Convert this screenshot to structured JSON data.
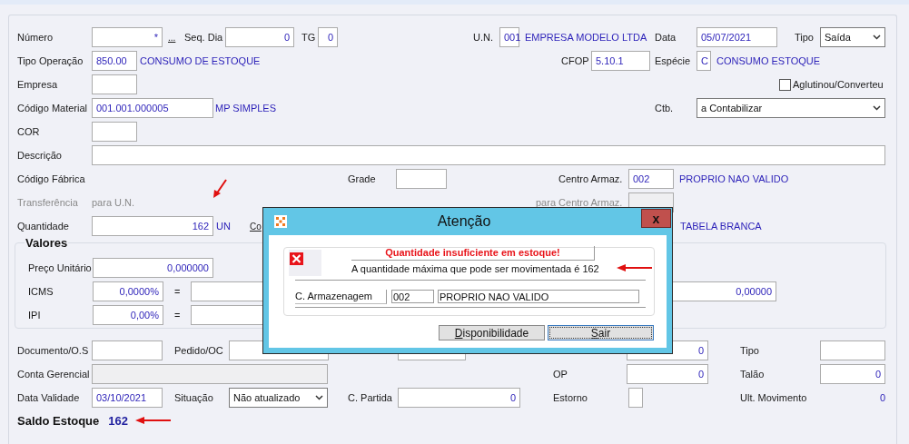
{
  "form": {
    "rows": [
      {
        "items": [
          {
            "kind": "label",
            "text": "Número"
          },
          {
            "kind": "field",
            "value": "*",
            "disabled": false
          },
          {
            "kind": "link",
            "text": "..."
          },
          {
            "kind": "label",
            "text": "Seq. Dia"
          },
          {
            "kind": "field",
            "value": "0",
            "disabled": false
          },
          {
            "kind": "label",
            "text": "TG"
          },
          {
            "kind": "field",
            "value": "0",
            "disabled": false
          },
          {
            "kind": "label",
            "text": "U.N."
          },
          {
            "kind": "field",
            "value": "001",
            "disabled": false
          },
          {
            "kind": "info",
            "text": "EMPRESA MODELO LTDA"
          },
          {
            "kind": "label",
            "text": "Data"
          },
          {
            "kind": "field",
            "value": "05/07/2021",
            "disabled": false
          },
          {
            "kind": "label",
            "text": "Tipo"
          },
          {
            "kind": "select",
            "value": "Saída"
          }
        ]
      },
      {
        "items": [
          {
            "kind": "label",
            "text": "Tipo Operação"
          },
          {
            "kind": "field",
            "value": "850.00",
            "disabled": false
          },
          {
            "kind": "info",
            "text": "CONSUMO DE ESTOQUE"
          },
          {
            "kind": "label",
            "text": "CFOP"
          },
          {
            "kind": "field",
            "value": "5.10.1",
            "disabled": false
          },
          {
            "kind": "label",
            "text": "Espécie"
          },
          {
            "kind": "field",
            "value": "C",
            "disabled": false
          },
          {
            "kind": "info",
            "text": "CONSUMO ESTOQUE"
          }
        ]
      },
      {
        "items": [
          {
            "kind": "label",
            "text": "Empresa"
          },
          {
            "kind": "field",
            "disabled": false
          },
          {
            "kind": "checkbox",
            "text": "Aglutinou/Converteu",
            "checked": false
          }
        ]
      },
      {
        "items": [
          {
            "kind": "label",
            "text": "Código Material"
          },
          {
            "kind": "field",
            "value": "001.001.000005",
            "disabled": false
          },
          {
            "kind": "info",
            "text": "MP SIMPLES"
          },
          {
            "kind": "label",
            "text": "Ctb."
          },
          {
            "kind": "select",
            "value": "a Contabilizar"
          }
        ]
      },
      {
        "items": [
          {
            "kind": "label",
            "text": "COR"
          },
          {
            "kind": "field",
            "disabled": false
          }
        ]
      },
      {
        "items": [
          {
            "kind": "label",
            "text": "Descrição"
          },
          {
            "kind": "field",
            "disabled": false
          }
        ]
      },
      {
        "items": [
          {
            "kind": "label",
            "text": "Código Fábrica"
          },
          {
            "kind": "label",
            "text": "Grade"
          },
          {
            "kind": "field",
            "disabled": false
          },
          {
            "kind": "label",
            "text": "Centro Armaz."
          },
          {
            "kind": "field",
            "value": "002",
            "disabled": false
          },
          {
            "kind": "info",
            "text": "PROPRIO NAO VALIDO"
          }
        ]
      },
      {
        "items": [
          {
            "kind": "muted",
            "text": "Transferência"
          },
          {
            "kind": "muted",
            "text": "para U.N."
          },
          {
            "kind": "muted",
            "text": "para Centro Armaz."
          },
          {
            "kind": "field",
            "disabled": true
          }
        ]
      },
      {
        "items": [
          {
            "kind": "label",
            "text": "Quantidade"
          },
          {
            "kind": "field",
            "value": "162",
            "disabled": false
          },
          {
            "kind": "info",
            "text": "UN"
          },
          {
            "kind": "link",
            "text": "Co"
          },
          {
            "kind": "info",
            "text": "TABELA BRANCA"
          }
        ]
      }
    ],
    "values": {
      "title": "Valores",
      "rows": [
        {
          "items": [
            {
              "kind": "label",
              "text": "Preço Unitário"
            },
            {
              "kind": "field",
              "value": "0,000000",
              "disabled": false
            }
          ]
        },
        {
          "items": [
            {
              "kind": "label",
              "text": "ICMS"
            },
            {
              "kind": "field",
              "value": "0,0000%",
              "disabled": false
            },
            {
              "kind": "label",
              "text": "="
            },
            {
              "kind": "field",
              "disabled": false
            },
            {
              "kind": "field",
              "value": "0,00000",
              "disabled": false
            }
          ]
        },
        {
          "items": [
            {
              "kind": "label",
              "text": "IPI"
            },
            {
              "kind": "field",
              "value": "0,00%",
              "disabled": false
            },
            {
              "kind": "label",
              "text": "="
            },
            {
              "kind": "field",
              "disabled": false
            }
          ]
        }
      ]
    },
    "bottom_rows": [
      {
        "items": [
          {
            "kind": "label",
            "text": "Documento/O.S"
          },
          {
            "kind": "field",
            "disabled": false
          },
          {
            "kind": "label",
            "text": "Pedido/OC"
          },
          {
            "kind": "field",
            "disabled": false
          },
          {
            "kind": "field",
            "disabled": false
          },
          {
            "kind": "field",
            "value": "0",
            "disabled": false
          },
          {
            "kind": "label",
            "text": "Tipo"
          },
          {
            "kind": "field",
            "disabled": false
          }
        ]
      },
      {
        "items": [
          {
            "kind": "label",
            "text": "Conta Gerencial"
          },
          {
            "kind": "field",
            "disabled": true
          },
          {
            "kind": "label",
            "text": "OP"
          },
          {
            "kind": "field",
            "value": "0",
            "disabled": false
          },
          {
            "kind": "label",
            "text": "Talão"
          },
          {
            "kind": "field",
            "value": "0",
            "disabled": false
          }
        ]
      },
      {
        "items": [
          {
            "kind": "label",
            "text": "Data Validade"
          },
          {
            "kind": "field",
            "value": "03/10/2021",
            "disabled": false
          },
          {
            "kind": "label",
            "text": "Situação"
          },
          {
            "kind": "select",
            "value": "Não atualizado"
          },
          {
            "kind": "label",
            "text": "C. Partida"
          },
          {
            "kind": "field",
            "value": "0",
            "disabled": false
          },
          {
            "kind": "label",
            "text": "Estorno"
          },
          {
            "kind": "field",
            "disabled": false
          },
          {
            "kind": "label",
            "text": "Ult. Movimento"
          },
          {
            "kind": "info",
            "text": "0"
          }
        ]
      }
    ],
    "saldo": {
      "label": "Saldo Estoque",
      "value": "162"
    }
  },
  "dialog": {
    "title": "Atenção",
    "close": "x",
    "header": "Quantidade insuficiente em estoque!",
    "message": "A quantidade máxima que pode ser movimentada é 162",
    "storage": {
      "label": "C. Armazenagem",
      "code": "002",
      "name": "PROPRIO NAO VALIDO"
    },
    "buttons": [
      {
        "label": "Disponibilidade",
        "focused": false
      },
      {
        "label": "Sair",
        "focused": true
      }
    ]
  }
}
